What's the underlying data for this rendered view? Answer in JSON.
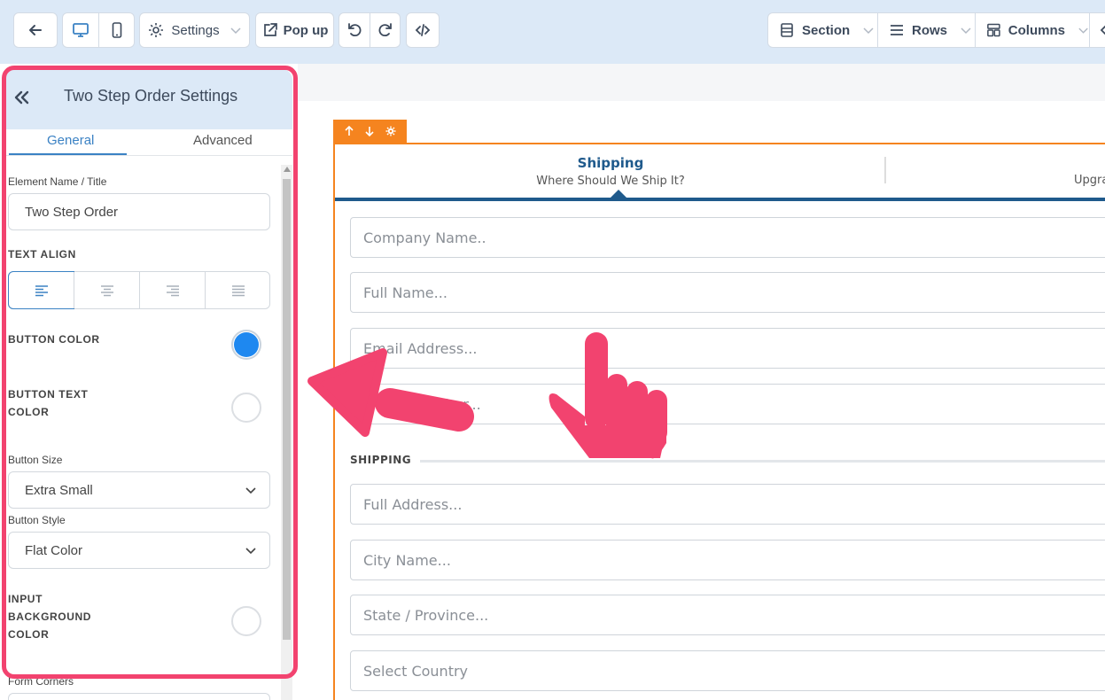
{
  "toolbar": {
    "settings_label": "Settings",
    "popup_label": "Pop up",
    "section_label": "Section",
    "rows_label": "Rows",
    "columns_label": "Columns"
  },
  "panel": {
    "title": "Two Step Order Settings",
    "tabs": [
      "General",
      "Advanced"
    ],
    "element_name_label": "Element Name / Title",
    "element_name_value": "Two Step Order",
    "text_align_label": "TEXT ALIGN",
    "button_color_label": "BUTTON COLOR",
    "button_color_value": "#1e88f0",
    "button_text_color_label_1": "BUTTON TEXT",
    "button_text_color_label_2": "COLOR",
    "button_size_label": "Button Size",
    "button_size_value": "Extra Small",
    "button_style_label": "Button Style",
    "button_style_value": "Flat Color",
    "input_bg_label_1": "INPUT",
    "input_bg_label_2": "BACKGROUND",
    "input_bg_label_3": "COLOR",
    "form_corners_label": "Form Corners"
  },
  "form": {
    "step1_title": "Shipping",
    "step1_subtitle": "Where Should We Ship It?",
    "step2_subtitle": "Upgra",
    "company_placeholder": "Company Name..",
    "fullname_placeholder": "Full Name...",
    "email_placeholder": "Email Address...",
    "phone_placeholder": "Phone Number...",
    "shipping_section_label": "SHIPPING",
    "address_placeholder": "Full Address...",
    "city_placeholder": "City Name...",
    "state_placeholder": "State / Province...",
    "country_placeholder": "Select Country"
  },
  "colors": {
    "accent": "#3b82c4",
    "highlight": "#f2436f",
    "section_orange": "#f5841f",
    "step_blue": "#1f5a8c"
  }
}
